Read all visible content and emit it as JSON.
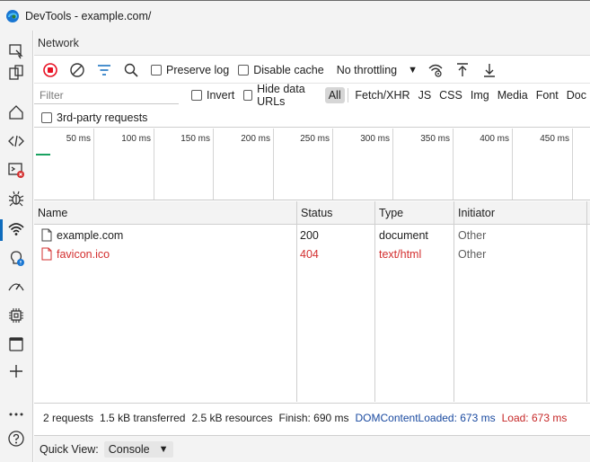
{
  "window": {
    "title": "DevTools - example.com/"
  },
  "panel": {
    "title": "Network"
  },
  "toolbar": {
    "preserve_log": "Preserve log",
    "disable_cache": "Disable cache",
    "throttling": "No throttling"
  },
  "filter": {
    "placeholder": "Filter",
    "invert": "Invert",
    "hide_data_urls": "Hide data URLs",
    "types": [
      "All",
      "Fetch/XHR",
      "JS",
      "CSS",
      "Img",
      "Media",
      "Font",
      "Doc"
    ],
    "third_party": "3rd-party requests"
  },
  "overview": {
    "ticks": [
      "50 ms",
      "100 ms",
      "150 ms",
      "200 ms",
      "250 ms",
      "300 ms",
      "350 ms",
      "400 ms",
      "450 ms"
    ]
  },
  "table": {
    "columns": [
      "Name",
      "Status",
      "Type",
      "Initiator"
    ],
    "rows": [
      {
        "name": "example.com",
        "status": "200",
        "type": "document",
        "initiator": "Other",
        "error": false
      },
      {
        "name": "favicon.ico",
        "status": "404",
        "type": "text/html",
        "initiator": "Other",
        "error": true
      }
    ]
  },
  "summary": {
    "requests": "2 requests",
    "transferred": "1.5 kB transferred",
    "resources": "2.5 kB resources",
    "finish": "Finish: 690 ms",
    "dom_content_loaded": "DOMContentLoaded: 673 ms",
    "load": "Load: 673 ms"
  },
  "quick_view": {
    "label": "Quick View:",
    "selected": "Console"
  },
  "colors": {
    "accent": "#0f6cbd",
    "error": "#d32f2f",
    "record": "#e81123",
    "dcl": "#1a4aa0"
  },
  "activity_icons": [
    "inspect-icon",
    "device-emulation-icon",
    "welcome-home-icon",
    "elements-icon",
    "console-icon",
    "sources-icon",
    "network-icon",
    "performance-insights-icon",
    "performance-icon",
    "memory-icon",
    "application-icon",
    "add-tool-icon",
    "more-tools-icon",
    "help-icon"
  ]
}
